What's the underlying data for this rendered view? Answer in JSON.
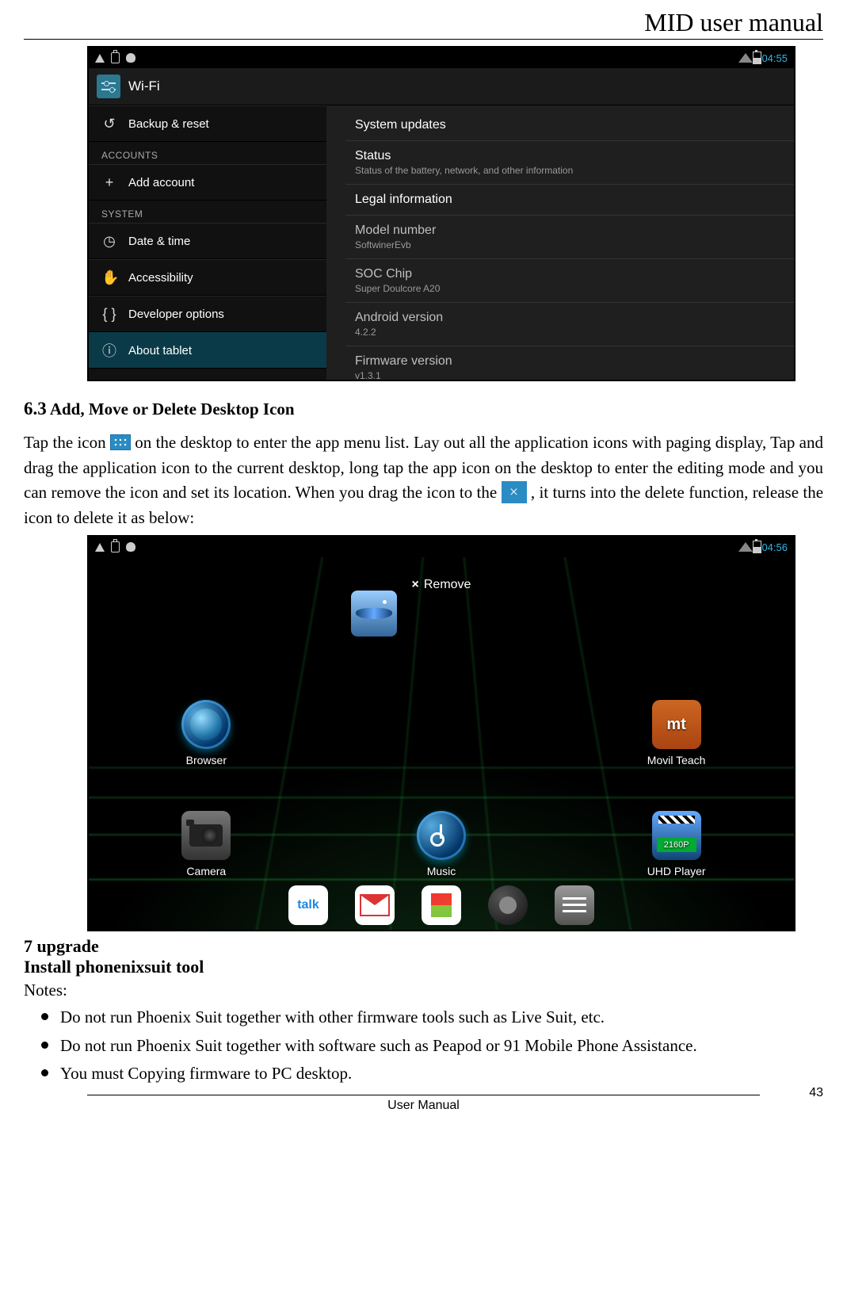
{
  "page": {
    "header": "MID user manual",
    "footer": "User Manual",
    "number": "43"
  },
  "screenshot1": {
    "status": {
      "time": "04:55"
    },
    "titlebar": {
      "title": "Wi-Fi"
    },
    "sidebar": {
      "items": [
        {
          "icon": "↺",
          "label": "Backup & reset"
        }
      ],
      "group1": "ACCOUNTS",
      "items2": [
        {
          "icon": "+",
          "label": "Add account"
        }
      ],
      "group2": "SYSTEM",
      "items3": [
        {
          "icon": "◷",
          "label": "Date & time"
        },
        {
          "icon": "✋",
          "label": "Accessibility"
        },
        {
          "icon": "{ }",
          "label": "Developer options"
        },
        {
          "icon": "ⓘ",
          "label": "About tablet"
        }
      ]
    },
    "pane": {
      "items": [
        {
          "title": "System updates"
        },
        {
          "title": "Status",
          "sub": "Status of the battery, network, and other information"
        },
        {
          "title": "Legal information"
        },
        {
          "title": "Model number",
          "sub": "SoftwinerEvb",
          "dim": true
        },
        {
          "title": "SOC Chip",
          "sub": "Super Doulcore A20",
          "dim": true
        },
        {
          "title": "Android version",
          "sub": "4.2.2",
          "dim": true
        },
        {
          "title": "Firmware version",
          "sub": "v1.3.1",
          "dim": true
        }
      ]
    }
  },
  "section63": {
    "heading_num": "6.3",
    "heading_text": " Add, Move or Delete Desktop Icon",
    "para1a": "Tap  the  icon ",
    "para1b": " on  the  desktop  to  enter  the  app  menu  list.    Lay  out  all  the  application  icons  with paging  display,  Tap  and  drag  the  application  icon  to  the  current  desktop,  long tap the app icon on the desktop to enter the editing mode and you can remove the icon and set its location. When you drag the icon to the",
    "para1c": ", it turns into the delete function, release the icon to delete it as below:"
  },
  "screenshot2": {
    "status": {
      "time": "04:56"
    },
    "remove": "Remove",
    "apps": {
      "row1": [
        "Browser",
        "",
        "Movil Teach"
      ],
      "row2": [
        "Camera",
        "Music",
        "UHD Player"
      ]
    },
    "uhd_band": "2160P",
    "talk": "talk"
  },
  "section7": {
    "heading": "7 upgrade",
    "subheading": "Install phonenixsuit tool",
    "notes": "Notes:",
    "bullets": [
      "Do not run Phoenix Suit together with other firmware tools such as Live Suit, etc.",
      "Do  not  run  Phoenix  Suit  together  with  software  such  as  Peapod  or  91  Mobile  Phone Assistance.",
      "You must Copying firmware to PC desktop."
    ]
  }
}
